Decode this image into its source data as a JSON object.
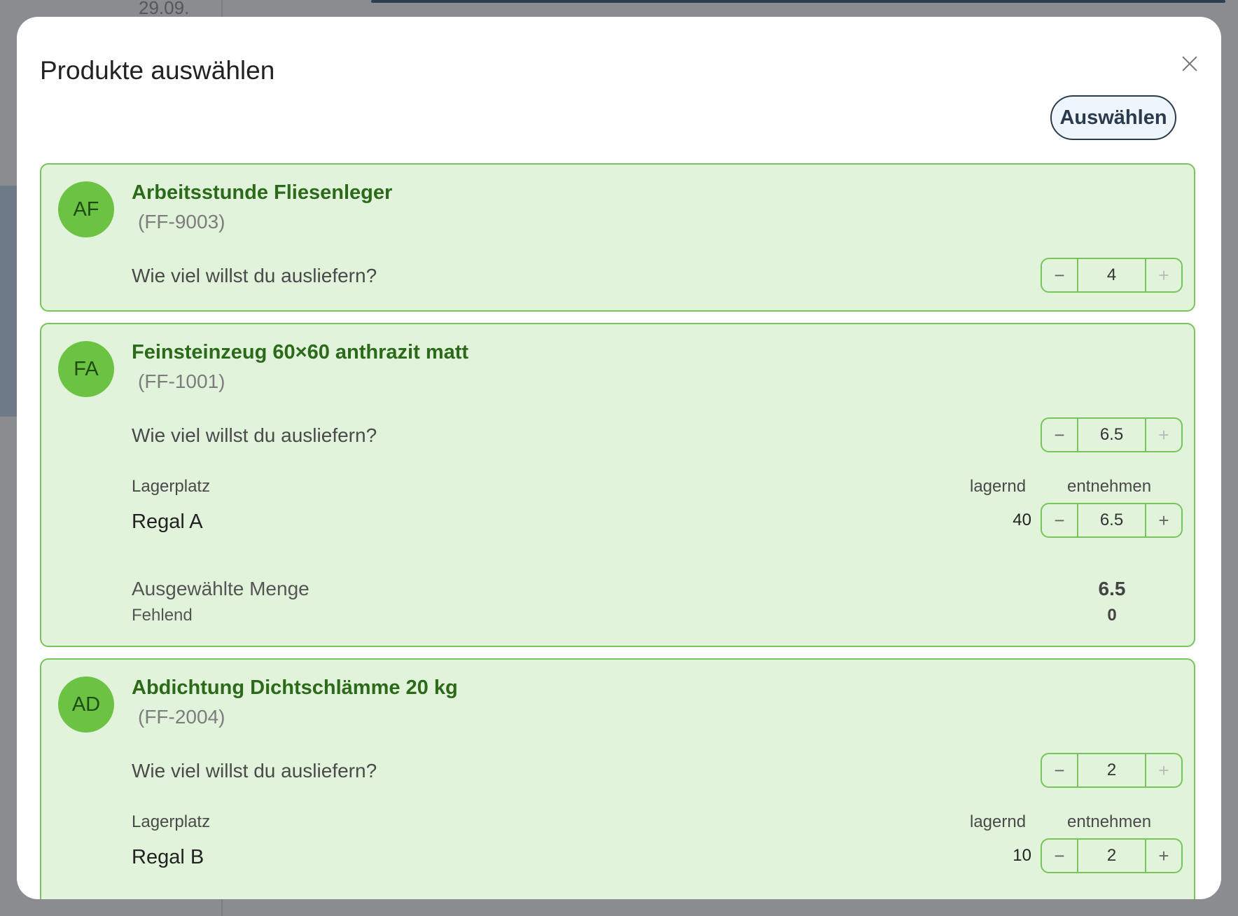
{
  "background": {
    "date": "29.09."
  },
  "modal": {
    "title": "Produkte auswählen",
    "select_label": "Auswählen",
    "close_icon": "close-icon"
  },
  "products": [
    {
      "initials": "AF",
      "name": "Arbeitsstunde Fliesenleger",
      "sku": "(FF-9003)",
      "question": "Wie viel willst du ausliefern?",
      "quantity": "4"
    },
    {
      "initials": "FA",
      "name": "Feinsteinzeug 60×60 anthrazit matt",
      "sku": "(FF-1001)",
      "question": "Wie viel willst du ausliefern?",
      "quantity": "6.5",
      "storage": {
        "header_location": "Lagerplatz",
        "header_stock": "lagernd",
        "header_take": "entnehmen",
        "location": "Regal A",
        "stock": "40",
        "take": "6.5"
      },
      "summary": {
        "selected_label": "Ausgewählte Menge",
        "selected_value": "6.5",
        "missing_label": "Fehlend",
        "missing_value": "0"
      }
    },
    {
      "initials": "AD",
      "name": "Abdichtung Dichtschlämme 20 kg",
      "sku": "(FF-2004)",
      "question": "Wie viel willst du ausliefern?",
      "quantity": "2",
      "storage": {
        "header_location": "Lagerplatz",
        "header_stock": "lagernd",
        "header_take": "entnehmen",
        "location": "Regal B",
        "stock": "10",
        "take": "2"
      }
    }
  ],
  "colors": {
    "card_bg": "#e2f3dc",
    "card_border": "#77c45a",
    "avatar_bg": "#6cc243",
    "product_name": "#2a6a18",
    "button_border": "#2a3b4d"
  }
}
